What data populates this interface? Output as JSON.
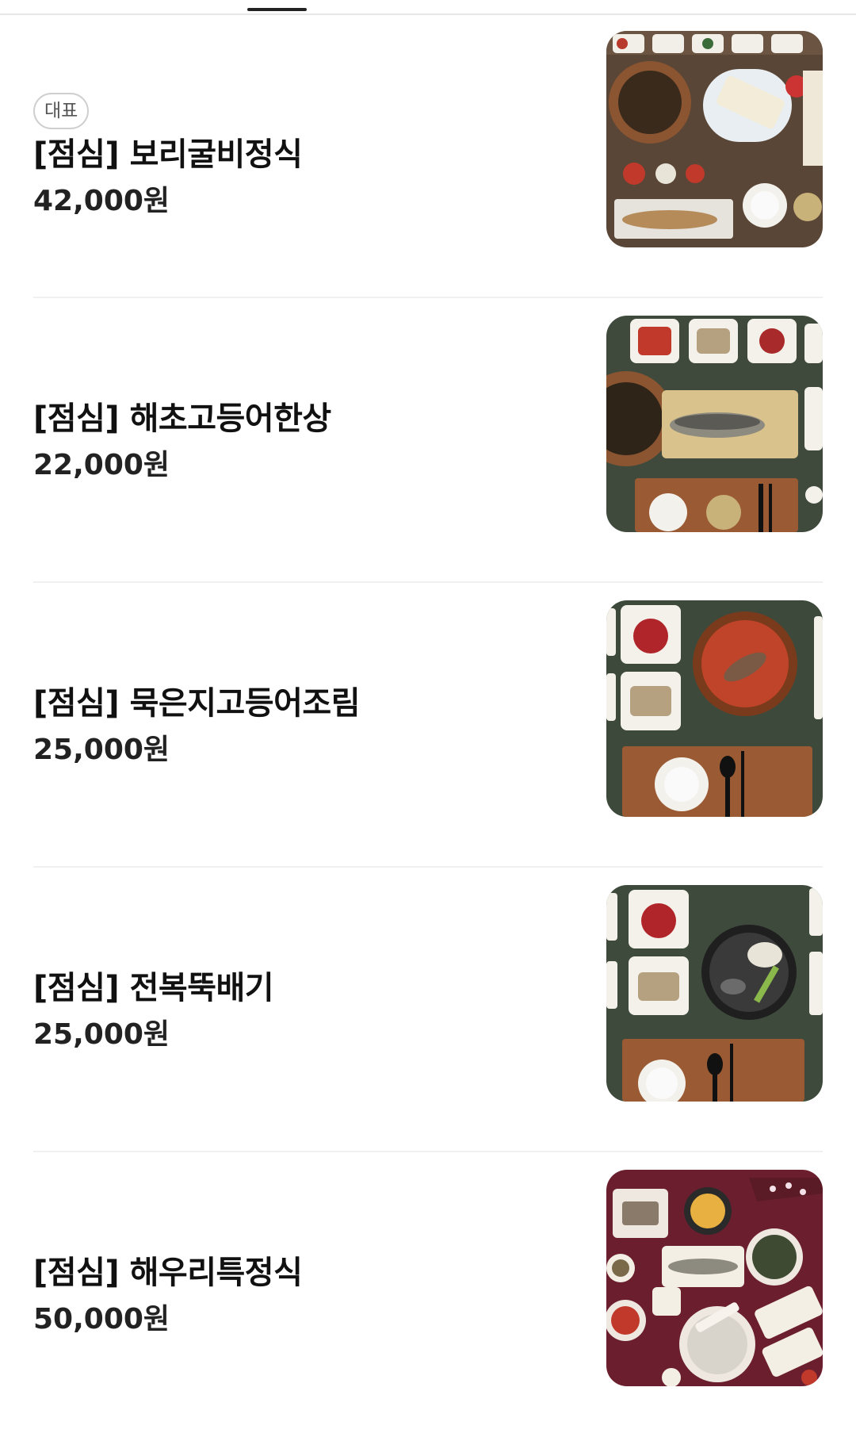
{
  "menu": {
    "items": [
      {
        "badge": "대표",
        "name": "[점심] 보리굴비정식",
        "price": "42,000원",
        "photo_icon": "food-photo",
        "bg": "#5a4636"
      },
      {
        "badge": "",
        "name": "[점심] 해초고등어한상",
        "price": "22,000원",
        "photo_icon": "food-photo",
        "bg": "#3f4a3c"
      },
      {
        "badge": "",
        "name": "[점심] 묵은지고등어조림",
        "price": "25,000원",
        "photo_icon": "food-photo",
        "bg": "#3d4a3b"
      },
      {
        "badge": "",
        "name": "[점심] 전복뚝배기",
        "price": "25,000원",
        "photo_icon": "food-photo",
        "bg": "#3e4b3c"
      },
      {
        "badge": "",
        "name": "[점심] 해우리특정식",
        "price": "50,000원",
        "photo_icon": "food-photo",
        "bg": "#6b1f2e"
      }
    ]
  }
}
